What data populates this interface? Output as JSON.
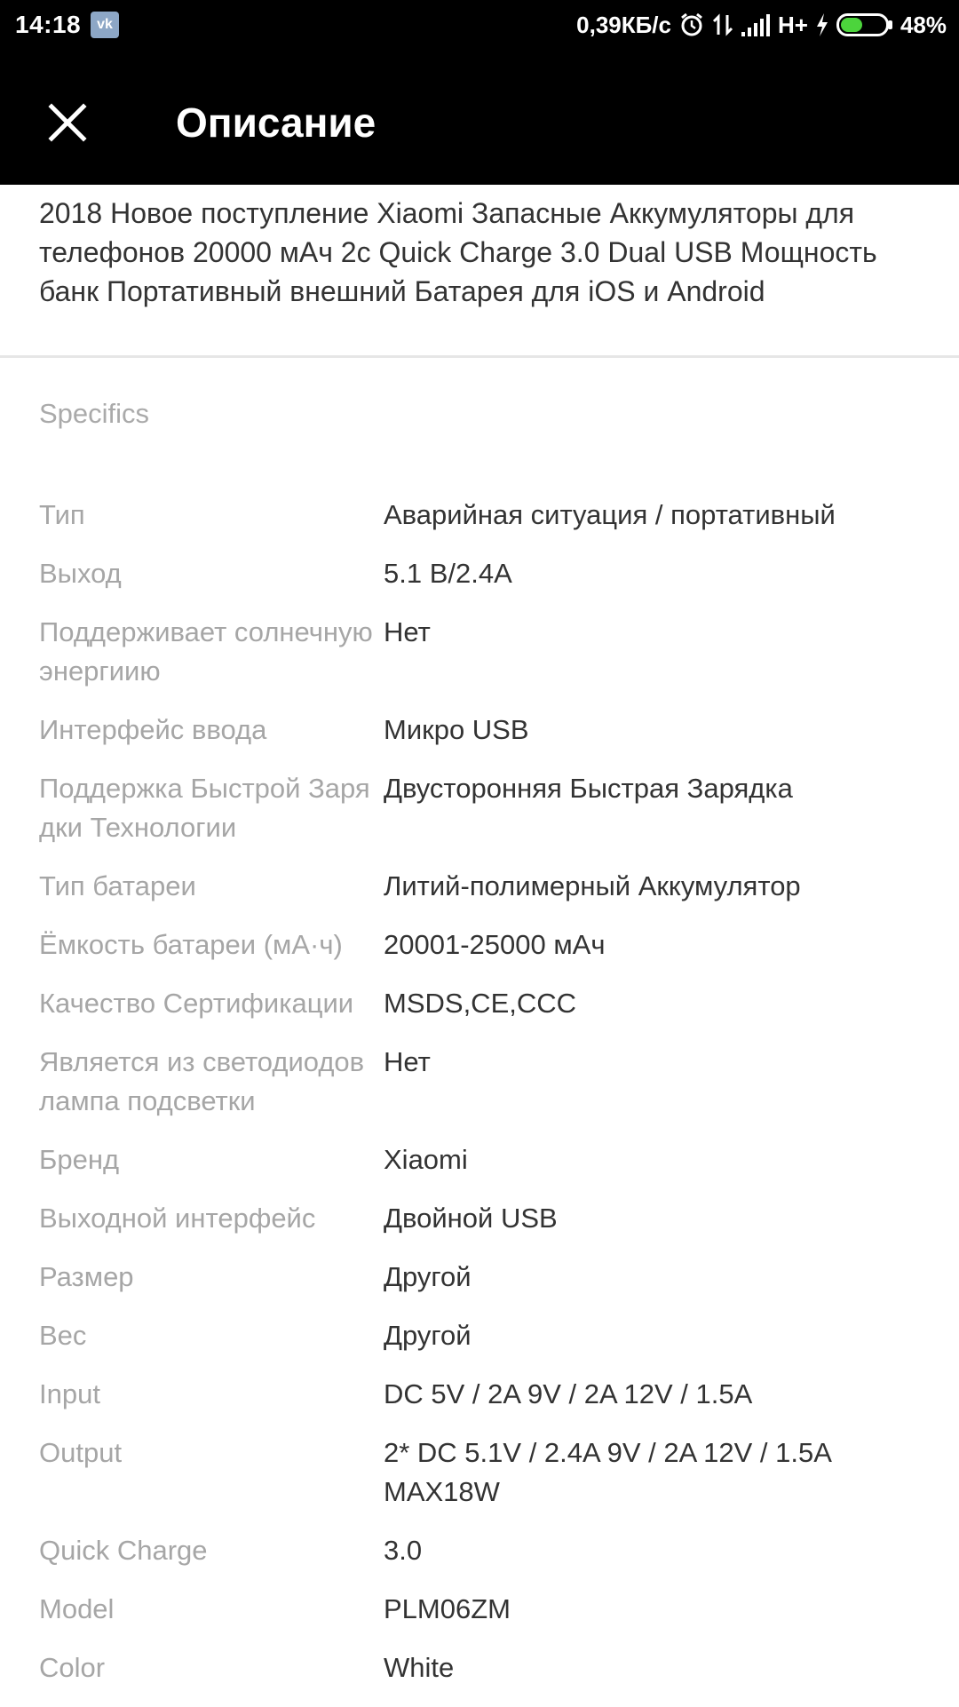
{
  "status_bar": {
    "time": "14:18",
    "vk_label": "vk",
    "network_speed": "0,39КБ/с",
    "network_type": "H+",
    "battery_percent": "48%",
    "battery_level": 0.48,
    "icons": [
      "vk-icon",
      "alarm-icon",
      "data-transfer-icon",
      "signal-icon",
      "charging-icon",
      "battery-icon"
    ]
  },
  "app_bar": {
    "title": "Описание",
    "close_icon": "close-icon"
  },
  "product": {
    "description": "2018 Новое поступление Xiaomi Запасные Аккумуляторы для телефонов 20000 мАч 2с Quick Charge 3.0 Dual USB Мощность банк Портативный внешний Батарея для iOS и Android"
  },
  "specifics": {
    "heading": "Specifics",
    "rows": [
      {
        "label": "Тип",
        "value": "Аварийная ситуация / портативный"
      },
      {
        "label": "Выход",
        "value": "5.1 В/2.4А"
      },
      {
        "label": "Поддерживает солнечную энергиию",
        "value": "Нет"
      },
      {
        "label": "Интерфейс ввода",
        "value": "Микро USB"
      },
      {
        "label": "Поддержка Быстрой Зарядки Технологии",
        "value": "Двусторонняя Быстрая Зарядка"
      },
      {
        "label": "Тип батареи",
        "value": "Литий-полимерный Аккумулятор"
      },
      {
        "label": "Ёмкость батареи (мА·ч)",
        "value": "20001-25000 мАч"
      },
      {
        "label": "Качество Сертификации",
        "value": "MSDS,CE,CCC"
      },
      {
        "label": "Является из светодиодов лампа подсветки",
        "value": "Нет"
      },
      {
        "label": "Бренд",
        "value": "Xiaomi"
      },
      {
        "label": "Выходной интерфейс",
        "value": "Двойной USB"
      },
      {
        "label": "Размер",
        "value": "Другой"
      },
      {
        "label": "Вес",
        "value": "Другой"
      },
      {
        "label": "Input",
        "value": "DC 5V / 2A 9V / 2A 12V / 1.5A"
      },
      {
        "label": "Output",
        "value": "2* DC 5.1V / 2.4A 9V / 2A 12V / 1.5A MAX18W"
      },
      {
        "label": "Quick Charge",
        "value": "3.0"
      },
      {
        "label": "Model",
        "value": "PLM06ZM"
      },
      {
        "label": "Color",
        "value": "White"
      }
    ]
  }
}
